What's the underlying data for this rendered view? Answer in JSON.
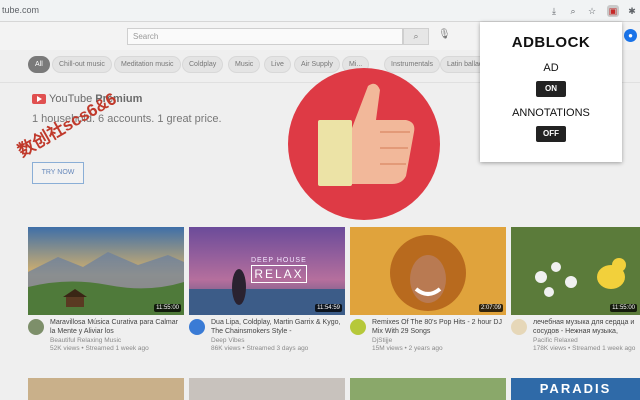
{
  "browser": {
    "url": "tube.com",
    "icons": [
      "download-icon",
      "zoom-icon",
      "star-icon",
      "extension-adblock-icon",
      "puzzle-icon"
    ]
  },
  "youtube": {
    "search": {
      "placeholder": "Search"
    },
    "chips": [
      "All",
      "Chill-out music",
      "Meditation music",
      "Coldplay",
      "Music",
      "Live",
      "Air Supply",
      "Mi...",
      "Instrumentals",
      "Latin ballad",
      "..."
    ],
    "premium": {
      "logo": "YouTube",
      "logo_bold": "Premium",
      "tagline": "1 household. 6 accounts. 1 great price.",
      "cta": "TRY NOW"
    },
    "videos": [
      {
        "duration": "11:55:00",
        "title": "Maravillosa Música Curativa para Calmar la Mente y Aliviar los",
        "channel": "Beautiful Relaxing Music",
        "meta": "52K views • Streamed 1 week ago",
        "color": "#5d8aa8"
      },
      {
        "duration": "11:54:59",
        "title": "Dua Lipa, Coldplay, Martin Garrix & Kygo, The Chainsmokers Style -",
        "channel": "Deep Vibes",
        "meta": "86K views • Streamed 3 days ago",
        "overlay_top": "DEEP HOUSE",
        "overlay_main": "RELAX",
        "color": "#7b4a8e"
      },
      {
        "duration": "2:07:09",
        "title": "Remixes Of The 80's Pop Hits - 2 hour DJ Mix With 29 Songs",
        "channel": "DjStijje",
        "meta": "15M views • 2 years ago",
        "color": "#d08a2c"
      },
      {
        "duration": "11:55:00",
        "title": "лечебная музыка для сердца и сосудов - Нежная музыка,",
        "channel": "Pacific Relaxed",
        "meta": "178K views • Streamed 1 week ago",
        "color": "#6e8f3a"
      }
    ],
    "row2_label": "PARADIS"
  },
  "popup": {
    "title": "ADBLOCK",
    "ad_label": "AD",
    "ad_state": "ON",
    "annotations_label": "ANNOTATIONS",
    "annotations_state": "OFF"
  },
  "watermark": "数创社scs6&6"
}
